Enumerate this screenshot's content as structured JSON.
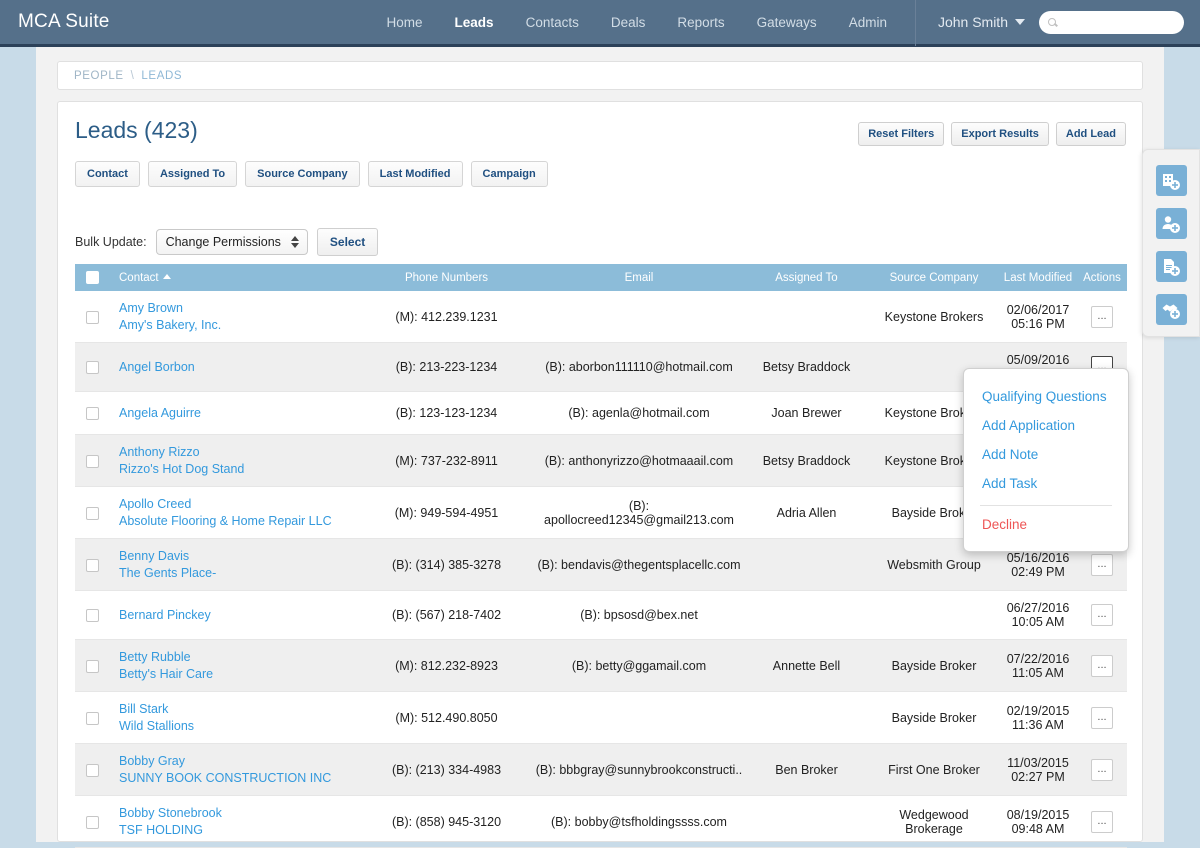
{
  "navbar": {
    "brand": "MCA Suite",
    "links": [
      {
        "label": "Home",
        "active": false
      },
      {
        "label": "Leads",
        "active": true
      },
      {
        "label": "Contacts",
        "active": false
      },
      {
        "label": "Deals",
        "active": false
      },
      {
        "label": "Reports",
        "active": false
      },
      {
        "label": "Gateways",
        "active": false
      },
      {
        "label": "Admin",
        "active": false
      }
    ],
    "user": "John Smith",
    "search_placeholder": "",
    "search_value": ""
  },
  "breadcrumb": {
    "root": "PEOPLE",
    "separator": "\\",
    "current": "LEADS"
  },
  "header": {
    "title": "Leads (423)",
    "buttons": [
      {
        "label": "Reset Filters"
      },
      {
        "label": "Export Results"
      },
      {
        "label": "Add Lead"
      }
    ]
  },
  "filters": [
    {
      "label": "Contact"
    },
    {
      "label": "Assigned To"
    },
    {
      "label": "Source Company"
    },
    {
      "label": "Last Modified"
    },
    {
      "label": "Campaign"
    }
  ],
  "bulk": {
    "label": "Bulk Update:",
    "selected": "Change Permissions",
    "options": [
      "Change Permissions"
    ],
    "select_button": "Select"
  },
  "table": {
    "columns": [
      {
        "key": "contact",
        "label": "Contact",
        "sorted": "asc"
      },
      {
        "key": "phone",
        "label": "Phone Numbers"
      },
      {
        "key": "email",
        "label": "Email"
      },
      {
        "key": "assigned",
        "label": "Assigned To"
      },
      {
        "key": "source",
        "label": "Source Company"
      },
      {
        "key": "modified",
        "label": "Last Modified"
      },
      {
        "key": "actions",
        "label": "Actions"
      }
    ],
    "rows": [
      {
        "name": "Amy Brown",
        "company": "Amy's Bakery, Inc.",
        "phone": "(M): 412.239.1231",
        "email": "",
        "assigned": "",
        "source": "Keystone Brokers",
        "modified": "02/06/2017 05:16 PM"
      },
      {
        "name": "Angel Borbon",
        "company": "",
        "phone": "(B): 213-223-1234",
        "email": "(B): aborbon111110@hotmail.com",
        "assigned": "Betsy Braddock",
        "source": "",
        "modified": "05/09/2016 04:28 PM"
      },
      {
        "name": "Angela Aguirre",
        "company": "",
        "phone": "(B): 123-123-1234",
        "email": "(B): agenla@hotmail.com",
        "assigned": "Joan Brewer",
        "source": "Keystone Brokers",
        "modified": ""
      },
      {
        "name": "Anthony Rizzo",
        "company": "Rizzo's Hot Dog Stand",
        "phone": "(M): 737-232-8911",
        "email": "(B): anthonyrizzo@hotmaaail.com",
        "assigned": "Betsy Braddock",
        "source": "Keystone Brokers",
        "modified": ""
      },
      {
        "name": "Apollo Creed",
        "company": "Absolute Flooring & Home Repair LLC",
        "phone": "(M): 949-594-4951",
        "email": "(B): apollocreed12345@gmail213.com",
        "assigned": "Adria Allen",
        "source": "Bayside Broker",
        "modified": ""
      },
      {
        "name": "Benny Davis",
        "company": "The Gents Place-",
        "phone": "(B): (314) 385-3278",
        "email": "(B): bendavis@thegentsplacellc.com",
        "assigned": "",
        "source": "Websmith Group",
        "modified": "05/16/2016 02:49 PM"
      },
      {
        "name": "Bernard Pinckey",
        "company": "",
        "phone": "(B): (567) 218-7402",
        "email": "(B): bpsosd@bex.net",
        "assigned": "",
        "source": "",
        "modified": "06/27/2016 10:05 AM"
      },
      {
        "name": "Betty Rubble",
        "company": "Betty's Hair Care",
        "phone": "(M): 812.232-8923",
        "email": "(B): betty@ggamail.com",
        "assigned": "Annette Bell",
        "source": "Bayside Broker",
        "modified": "07/22/2016 11:05 AM"
      },
      {
        "name": "Bill Stark",
        "company": "Wild Stallions",
        "phone": "(M): 512.490.8050",
        "email": "",
        "assigned": "",
        "source": "Bayside Broker",
        "modified": "02/19/2015 11:36 AM"
      },
      {
        "name": "Bobby Gray",
        "company": "SUNNY BOOK CONSTRUCTION INC",
        "phone": "(B): (213) 334-4983",
        "email": "(B): bbbgray@sunnybrookconstructi..",
        "assigned": "Ben Broker",
        "source": "First One Broker",
        "modified": "11/03/2015 02:27 PM"
      },
      {
        "name": "Bobby Stonebrook",
        "company": "TSF HOLDING",
        "phone": "(B): (858) 945-3120",
        "email": "(B): bobby@tsfholdingssss.com",
        "assigned": "",
        "source": "Wedgewood Brokerage",
        "modified": "08/19/2015 09:48 AM"
      }
    ],
    "row_action_label": "..."
  },
  "action_menu": {
    "items": [
      {
        "label": "Qualifying Questions",
        "danger": false
      },
      {
        "label": "Add Application",
        "danger": false
      },
      {
        "label": "Add Note",
        "danger": false
      },
      {
        "label": "Add Task",
        "danger": false
      },
      {
        "label": "Decline",
        "danger": true
      }
    ]
  },
  "quick_rail": {
    "buttons": [
      {
        "icon": "add-company-icon"
      },
      {
        "icon": "add-contact-icon"
      },
      {
        "icon": "add-document-icon"
      },
      {
        "icon": "add-deal-icon"
      }
    ]
  },
  "colors": {
    "navbar": "#55708a",
    "navbar_border": "#2c4159",
    "page_accent": "#2c5d87",
    "table_header": "#8cbcd9",
    "link": "#3399dd",
    "danger": "#ee5555",
    "rail_icon": "#79b0d6",
    "page_margin": "#c8dbe8"
  }
}
